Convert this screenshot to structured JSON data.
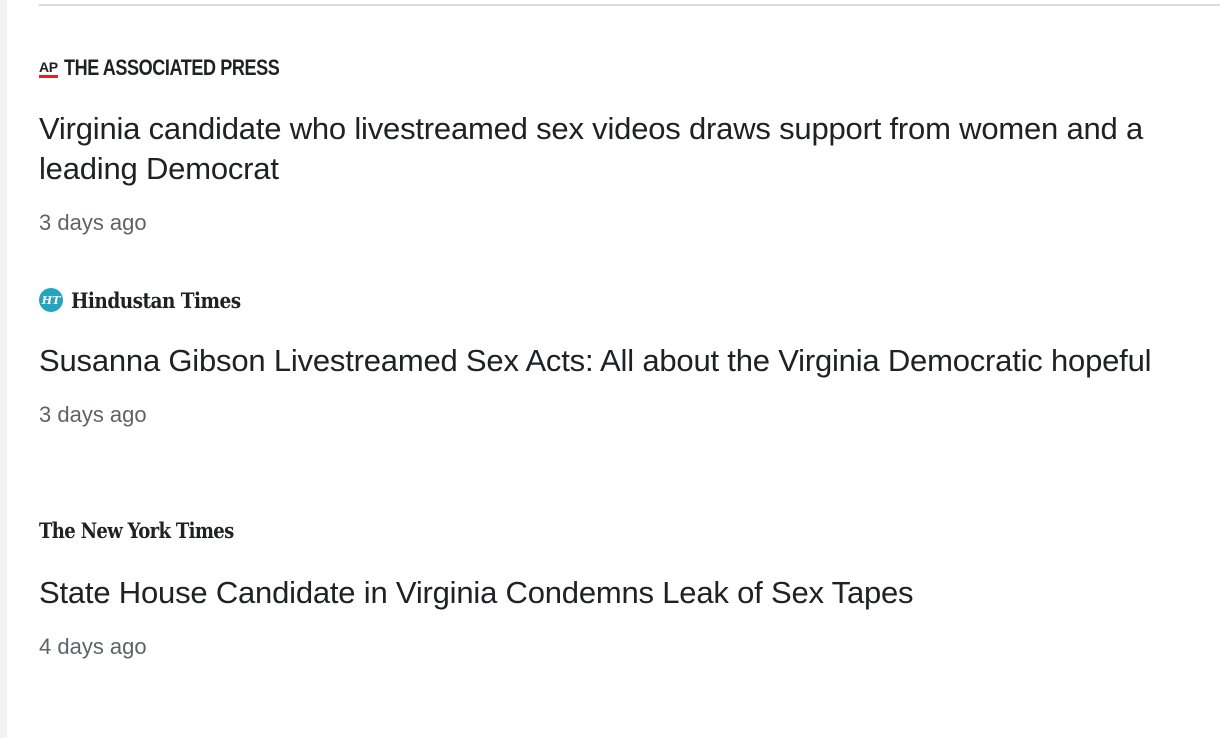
{
  "articles": [
    {
      "source": {
        "name": "THE ASSOCIATED PRESS",
        "mark": "AP",
        "mark_color": "#e41f26"
      },
      "headline": "Virginia candidate who livestreamed sex videos draws support from women and a leading Democrat",
      "time": "3 days ago"
    },
    {
      "source": {
        "name": "Hindustan Times",
        "mark": "HT",
        "mark_color": "#24a5bf"
      },
      "headline": "Susanna Gibson Livestreamed Sex Acts: All about the Virginia Democratic hopeful",
      "time": "3 days ago"
    },
    {
      "source": {
        "name": "The New York Times"
      },
      "headline": "State House Candidate in Virginia Condemns Leak of Sex Tapes",
      "time": "4 days ago"
    }
  ]
}
